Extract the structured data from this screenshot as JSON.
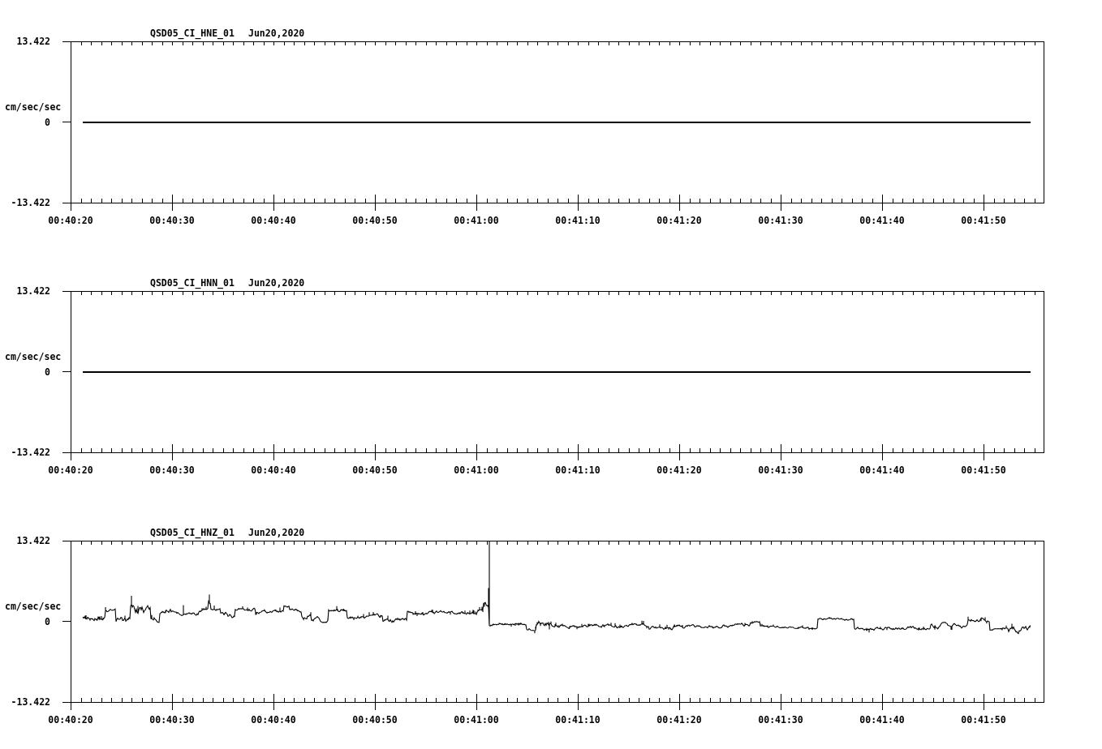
{
  "plots": [
    {
      "station": "QSD05_CI_HNE_01",
      "date": "Jun20,2020",
      "unit": "cm/sec/sec",
      "y_labels": [
        "13.422",
        "0",
        "-13.422"
      ],
      "x_labels": [
        "00:40:20",
        "00:40:30",
        "00:40:40",
        "00:40:50",
        "00:41:00",
        "00:41:10",
        "00:41:20",
        "00:41:30",
        "00:41:40",
        "00:41:50"
      ],
      "kind": "flat"
    },
    {
      "station": "QSD05_CI_HNN_01",
      "date": "Jun20,2020",
      "unit": "cm/sec/sec",
      "y_labels": [
        "13.422",
        "0",
        "-13.422"
      ],
      "x_labels": [
        "00:40:20",
        "00:40:30",
        "00:40:40",
        "00:40:50",
        "00:41:00",
        "00:41:10",
        "00:41:20",
        "00:41:30",
        "00:41:40",
        "00:41:50"
      ],
      "kind": "flat"
    },
    {
      "station": "QSD05_CI_HNZ_01",
      "date": "Jun20,2020",
      "unit": "cm/sec/sec",
      "y_labels": [
        "13.422",
        "0",
        "-13.422"
      ],
      "x_labels": [
        "00:40:20",
        "00:40:30",
        "00:40:40",
        "00:40:50",
        "00:41:00",
        "00:41:10",
        "00:41:20",
        "00:41:30",
        "00:41:40",
        "00:41:50"
      ],
      "kind": "waveform"
    }
  ]
}
